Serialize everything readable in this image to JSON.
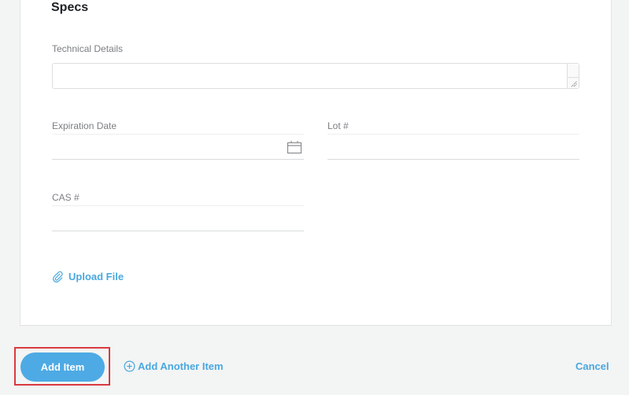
{
  "section": {
    "title": "Specs"
  },
  "fields": {
    "technical_details": {
      "label": "Technical Details",
      "value": "",
      "placeholder": ""
    },
    "expiration_date": {
      "label": "Expiration Date",
      "value": "",
      "placeholder": "",
      "icon": "calendar-icon"
    },
    "lot_number": {
      "label": "Lot #",
      "value": "",
      "placeholder": ""
    },
    "cas_number": {
      "label": "CAS #",
      "value": "",
      "placeholder": ""
    }
  },
  "upload": {
    "label": "Upload File",
    "icon": "paperclip-icon"
  },
  "footer": {
    "add_item_label": "Add Item",
    "add_another_label": "Add Another Item",
    "add_another_icon": "plus-circle-icon",
    "cancel_label": "Cancel"
  },
  "colors": {
    "accent": "#4eaae4",
    "link": "#4aa8e0",
    "highlight": "#d9393e",
    "background": "#f3f4f4"
  }
}
